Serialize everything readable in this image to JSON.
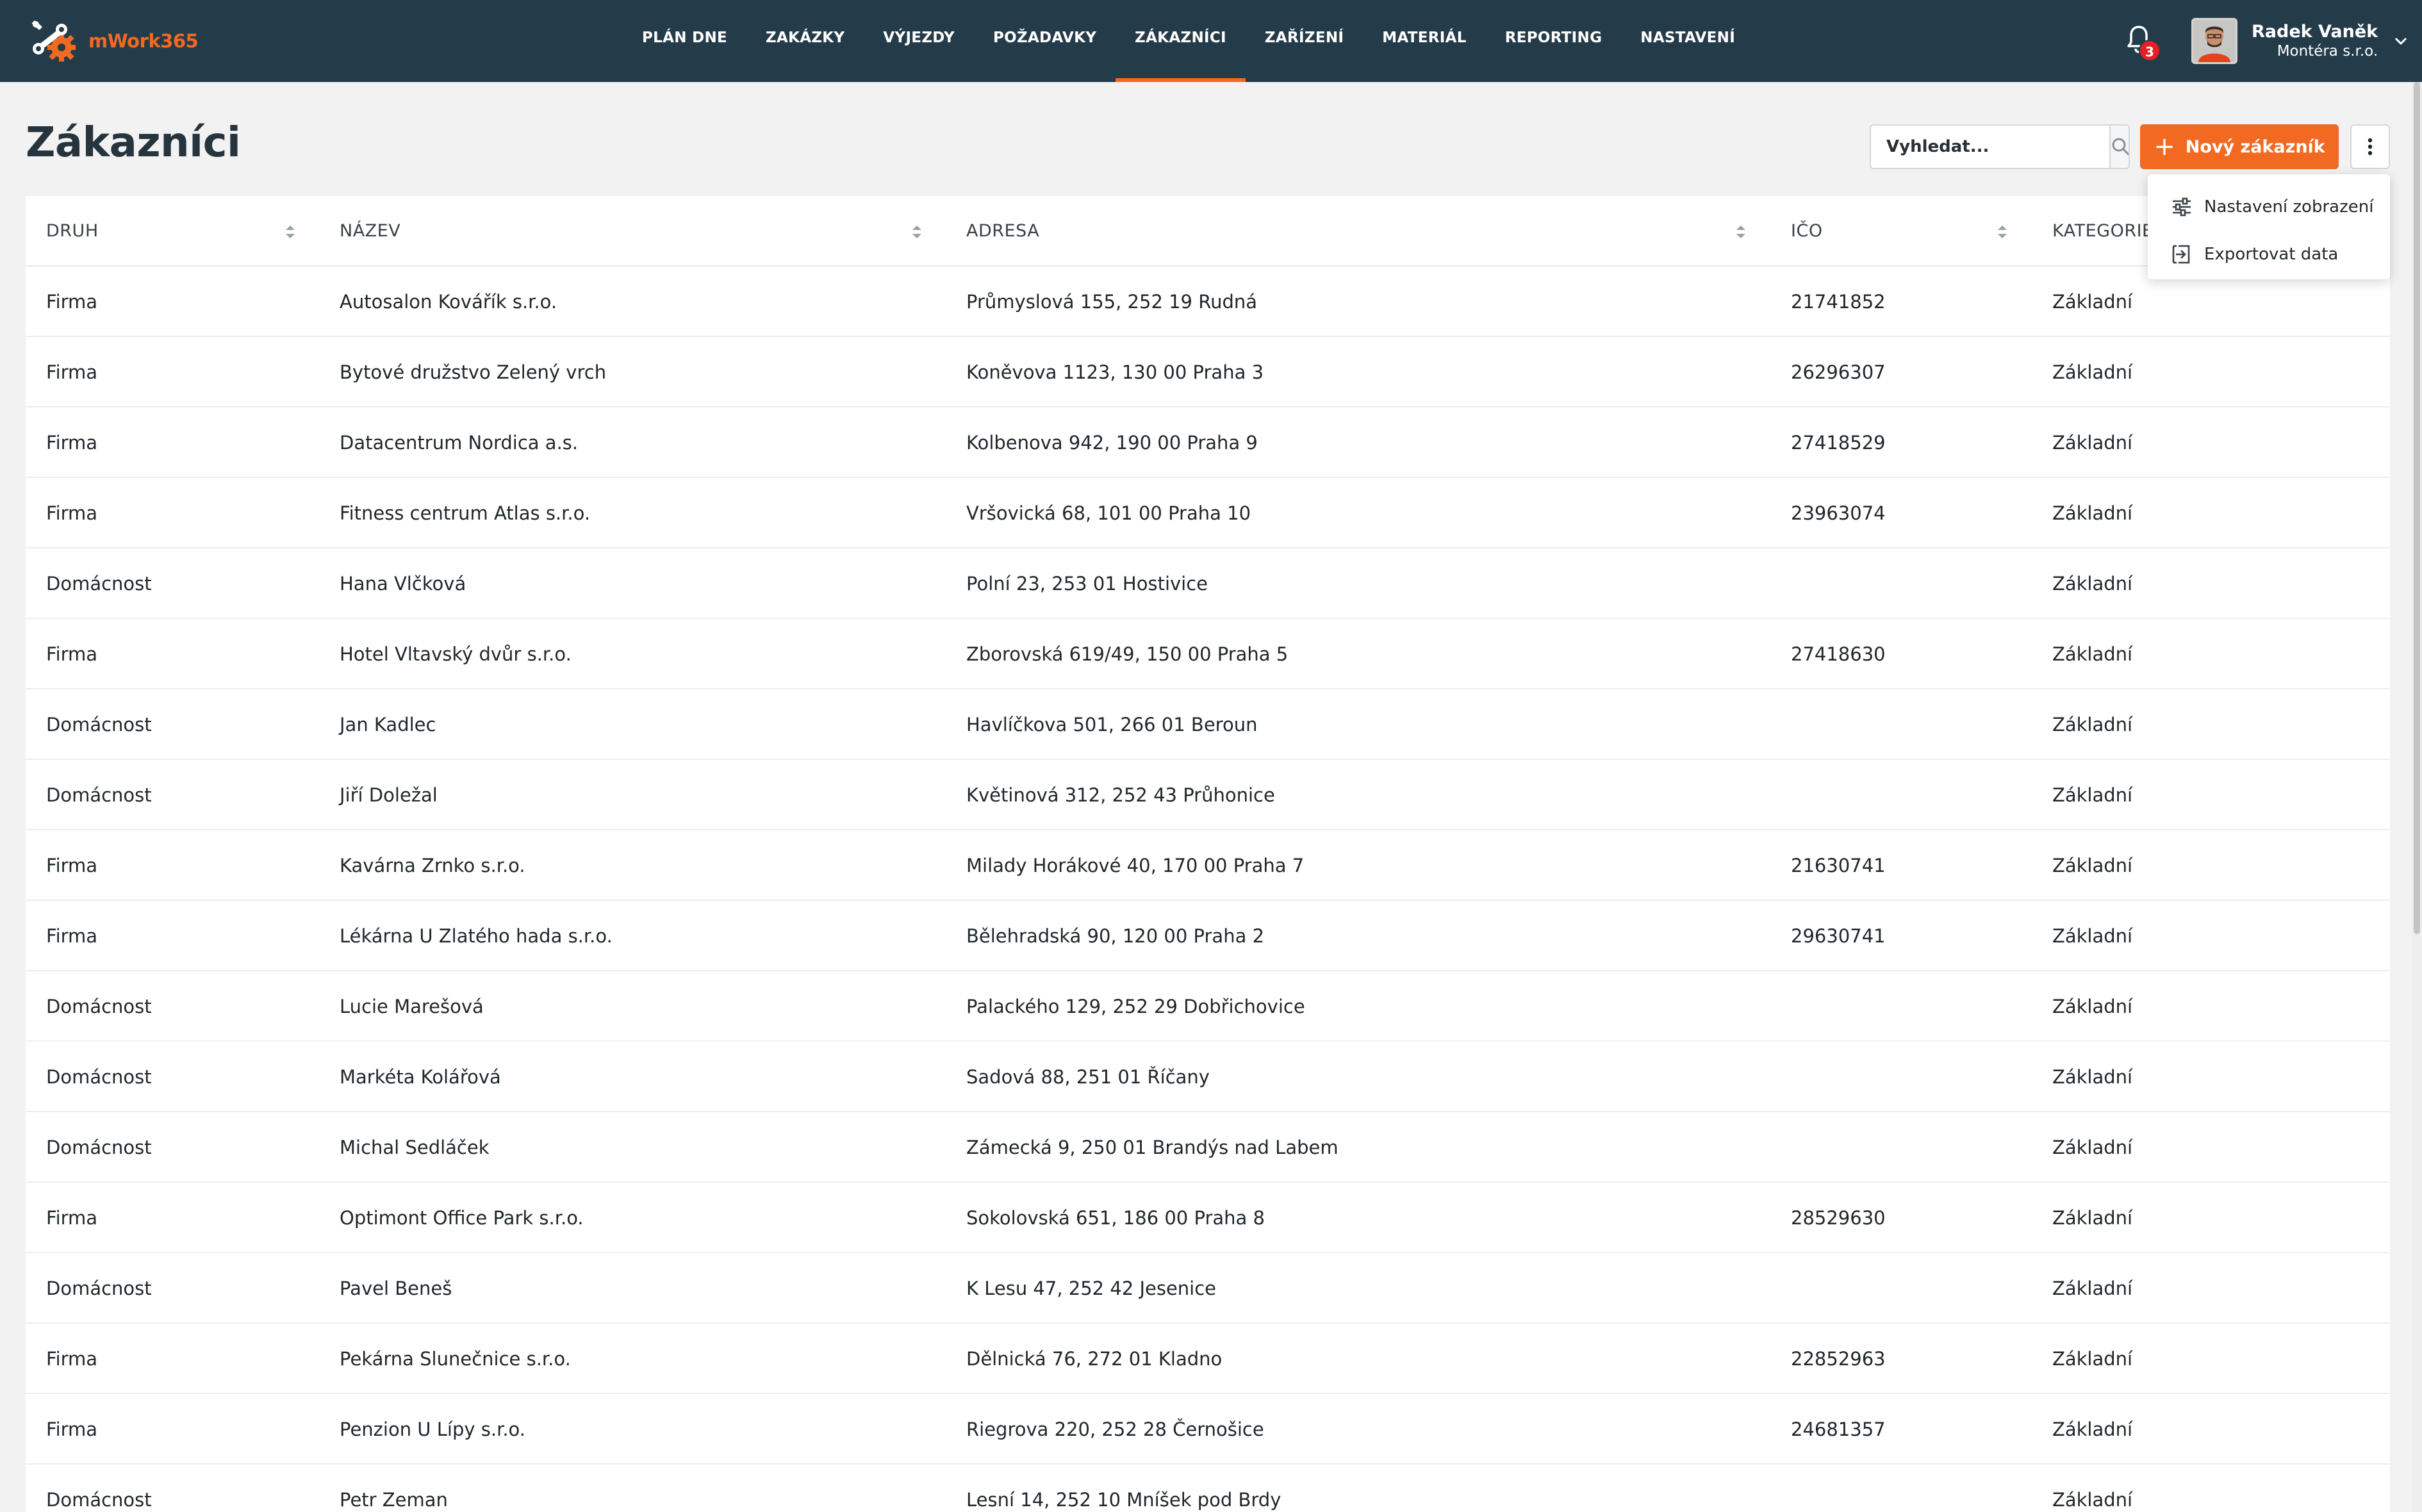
{
  "app": {
    "name": "mWork365",
    "accent_color": "#f26a21",
    "nav_color": "#243b4a"
  },
  "nav": {
    "items": [
      {
        "label": "PLÁN DNE",
        "active": false
      },
      {
        "label": "ZAKÁZKY",
        "active": false
      },
      {
        "label": "VÝJEZDY",
        "active": false
      },
      {
        "label": "POŽADAVKY",
        "active": false
      },
      {
        "label": "ZÁKAZNÍCI",
        "active": true
      },
      {
        "label": "ZAŘÍZENÍ",
        "active": false
      },
      {
        "label": "MATERIÁL",
        "active": false
      },
      {
        "label": "REPORTING",
        "active": false
      },
      {
        "label": "NASTAVENÍ",
        "active": false
      }
    ]
  },
  "notifications": {
    "icon": "bell-icon",
    "count": "3"
  },
  "user": {
    "name": "Radek Vaněk",
    "company": "Montéra s.r.o."
  },
  "page": {
    "title": "Zákazníci"
  },
  "search": {
    "placeholder": "Vyhledat..."
  },
  "toolbar": {
    "new_label": "Nový zákazník"
  },
  "menu": {
    "items": [
      {
        "label": "Nastavení zobrazení",
        "icon": "sliders-icon"
      },
      {
        "label": "Exportovat data",
        "icon": "export-icon"
      }
    ]
  },
  "table": {
    "columns": [
      "DRUH",
      "NÁZEV",
      "ADRESA",
      "IČO",
      "KATEGORIE"
    ],
    "rows": [
      [
        "Firma",
        "Autosalon Kovářík s.r.o.",
        "Průmyslová 155, 252 19 Rudná",
        "21741852",
        "Základní"
      ],
      [
        "Firma",
        "Bytové družstvo Zelený vrch",
        "Koněvova 1123, 130 00 Praha 3",
        "26296307",
        "Základní"
      ],
      [
        "Firma",
        "Datacentrum Nordica a.s.",
        "Kolbenova 942, 190 00 Praha 9",
        "27418529",
        "Základní"
      ],
      [
        "Firma",
        "Fitness centrum Atlas s.r.o.",
        "Vršovická 68, 101 00 Praha 10",
        "23963074",
        "Základní"
      ],
      [
        "Domácnost",
        "Hana Vlčková",
        "Polní 23, 253 01 Hostivice",
        "",
        "Základní"
      ],
      [
        "Firma",
        "Hotel Vltavský dvůr s.r.o.",
        "Zborovská 619/49, 150 00 Praha 5",
        "27418630",
        "Základní"
      ],
      [
        "Domácnost",
        "Jan Kadlec",
        "Havlíčkova 501, 266 01 Beroun",
        "",
        "Základní"
      ],
      [
        "Domácnost",
        "Jiří Doležal",
        "Květinová 312, 252 43 Průhonice",
        "",
        "Základní"
      ],
      [
        "Firma",
        "Kavárna Zrnko s.r.o.",
        "Milady Horákové 40, 170 00 Praha 7",
        "21630741",
        "Základní"
      ],
      [
        "Firma",
        "Lékárna U Zlatého hada s.r.o.",
        "Bělehradská 90, 120 00 Praha 2",
        "29630741",
        "Základní"
      ],
      [
        "Domácnost",
        "Lucie Marešová",
        "Palackého 129, 252 29 Dobřichovice",
        "",
        "Základní"
      ],
      [
        "Domácnost",
        "Markéta Kolářová",
        "Sadová 88, 251 01 Říčany",
        "",
        "Základní"
      ],
      [
        "Domácnost",
        "Michal Sedláček",
        "Zámecká 9, 250 01 Brandýs nad Labem",
        "",
        "Základní"
      ],
      [
        "Firma",
        "Optimont Office Park s.r.o.",
        "Sokolovská 651, 186 00 Praha 8",
        "28529630",
        "Základní"
      ],
      [
        "Domácnost",
        "Pavel Beneš",
        "K Lesu 47, 252 42 Jesenice",
        "",
        "Základní"
      ],
      [
        "Firma",
        "Pekárna Slunečnice s.r.o.",
        "Dělnická 76, 272 01 Kladno",
        "22852963",
        "Základní"
      ],
      [
        "Firma",
        "Penzion U Lípy s.r.o.",
        "Riegrova 220, 252 28 Černošice",
        "24681357",
        "Základní"
      ],
      [
        "Domácnost",
        "Petr Zeman",
        "Lesní 14, 252 10 Mníšek pod Brdy",
        "",
        "Základní"
      ]
    ]
  }
}
